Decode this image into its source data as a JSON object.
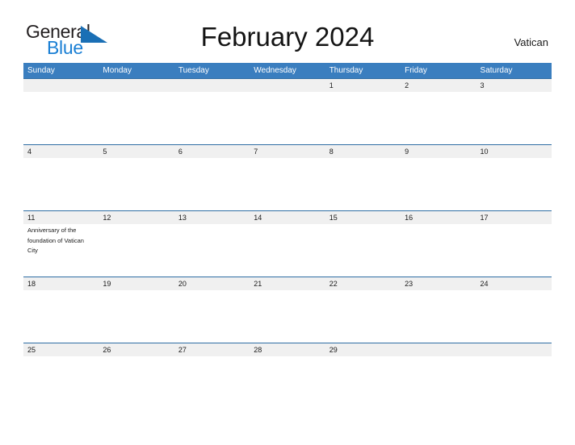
{
  "brand": {
    "name_part1": "General",
    "name_part2": "Blue",
    "flag_icon": "blue-triangle-flag-icon",
    "color_black": "#231f20",
    "color_blue": "#1a7fd4"
  },
  "header": {
    "title": "February 2024",
    "region": "Vatican"
  },
  "calendar": {
    "accent_color": "#3a7ebf",
    "band_color": "#f0f0f0",
    "rule_color": "#2e6da4",
    "weekdays": [
      "Sunday",
      "Monday",
      "Tuesday",
      "Wednesday",
      "Thursday",
      "Friday",
      "Saturday"
    ],
    "weeks": [
      {
        "dates": [
          "",
          "",
          "",
          "",
          "1",
          "2",
          "3"
        ],
        "events": [
          "",
          "",
          "",
          "",
          "",
          "",
          ""
        ]
      },
      {
        "dates": [
          "4",
          "5",
          "6",
          "7",
          "8",
          "9",
          "10"
        ],
        "events": [
          "",
          "",
          "",
          "",
          "",
          "",
          ""
        ]
      },
      {
        "dates": [
          "11",
          "12",
          "13",
          "14",
          "15",
          "16",
          "17"
        ],
        "events": [
          "Anniversary of the foundation of Vatican City",
          "",
          "",
          "",
          "",
          "",
          ""
        ]
      },
      {
        "dates": [
          "18",
          "19",
          "20",
          "21",
          "22",
          "23",
          "24"
        ],
        "events": [
          "",
          "",
          "",
          "",
          "",
          "",
          ""
        ]
      },
      {
        "dates": [
          "25",
          "26",
          "27",
          "28",
          "29",
          "",
          ""
        ],
        "events": [
          "",
          "",
          "",
          "",
          "",
          "",
          ""
        ]
      }
    ]
  }
}
